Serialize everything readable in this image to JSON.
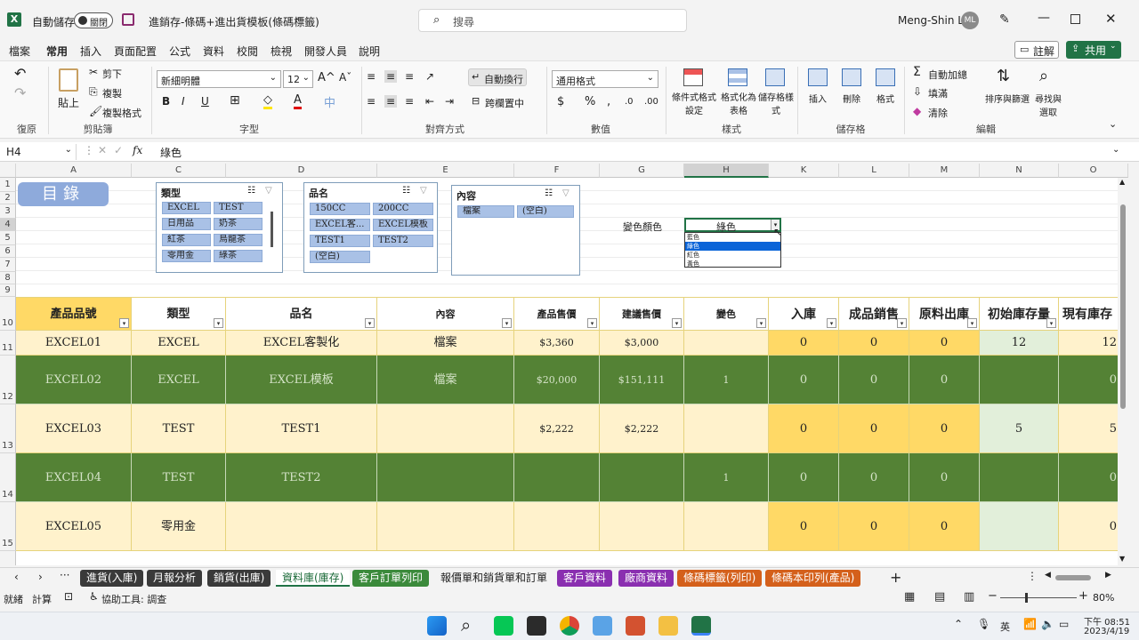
{
  "titlebar": {
    "autosave_label": "自動儲存",
    "autosave_state": "關閉",
    "doc_title": "進銷存-條碼+進出貨模板(條碼標籤)",
    "search_placeholder": "搜尋",
    "user_name": "Meng-Shin Li",
    "user_initials": "ML"
  },
  "menu": {
    "items": [
      "檔案",
      "常用",
      "插入",
      "頁面配置",
      "公式",
      "資料",
      "校閱",
      "檢視",
      "開發人員",
      "說明"
    ],
    "comment_label": "註解",
    "share_label": "共用"
  },
  "ribbon": {
    "undo_group": "復原",
    "clipboard": {
      "paste": "貼上",
      "cut": "剪下",
      "copy": "複製",
      "format_painter": "複製格式",
      "label": "剪貼簿"
    },
    "font": {
      "name": "新細明體",
      "size": "12",
      "label": "字型"
    },
    "align": {
      "wrap": "自動換行",
      "merge": "跨欄置中",
      "label": "對齊方式"
    },
    "number": {
      "format": "通用格式",
      "label": "數值"
    },
    "styles": {
      "conditional": "條件式格式設定",
      "table": "格式化為表格",
      "cell_styles": "儲存格樣式",
      "label": "樣式"
    },
    "cells": {
      "insert": "插入",
      "delete": "刪除",
      "format": "格式",
      "label": "儲存格"
    },
    "editing": {
      "autosum": "自動加總",
      "fill": "填滿",
      "clear": "清除",
      "sort": "排序與篩選",
      "find": "尋找與選取",
      "label": "編輯"
    }
  },
  "formula": {
    "name_box": "H4",
    "fx": "fx",
    "value": "綠色"
  },
  "columns": [
    "A",
    "C",
    "D",
    "E",
    "F",
    "G",
    "H",
    "K",
    "L",
    "M",
    "N",
    "O"
  ],
  "rows": [
    "1",
    "2",
    "3",
    "4",
    "5",
    "6",
    "7",
    "8",
    "9",
    "10",
    "11",
    "12",
    "13",
    "14",
    "15"
  ],
  "catalog_button": "目錄",
  "slicers": {
    "type": {
      "title": "類型",
      "items": [
        "EXCEL",
        "TEST",
        "日用品",
        "奶茶",
        "紅茶",
        "烏龍茶",
        "零用金",
        "綠茶"
      ]
    },
    "name": {
      "title": "品名",
      "items": [
        "150CC",
        "200CC",
        "EXCEL客...",
        "EXCEL模板",
        "TEST1",
        "TEST2",
        "(空白)"
      ]
    },
    "content": {
      "title": "內容",
      "items": [
        "檔案",
        "(空白)"
      ]
    }
  },
  "color_picker": {
    "label": "變色顏色",
    "value": "綠色",
    "options": [
      "藍色",
      "綠色",
      "紅色",
      "黃色"
    ]
  },
  "table": {
    "headers": [
      "產品品號",
      "類型",
      "品名",
      "內容",
      "產品售價",
      "建議售價",
      "變色",
      "入庫",
      "成品銷售",
      "原料出庫",
      "初始庫存量",
      "現有庫存"
    ],
    "rows": [
      [
        "EXCEL01",
        "EXCEL",
        "EXCEL客製化",
        "檔案",
        "$3,360",
        "$3,000",
        "",
        "0",
        "0",
        "0",
        "12",
        "12"
      ],
      [
        "EXCEL02",
        "EXCEL",
        "EXCEL模板",
        "檔案",
        "$20,000",
        "$151,111",
        "1",
        "0",
        "0",
        "0",
        "",
        "0"
      ],
      [
        "EXCEL03",
        "TEST",
        "TEST1",
        "",
        "$2,222",
        "$2,222",
        "",
        "0",
        "0",
        "0",
        "5",
        "5"
      ],
      [
        "EXCEL04",
        "TEST",
        "TEST2",
        "",
        "",
        "",
        "1",
        "0",
        "0",
        "0",
        "",
        "0"
      ],
      [
        "EXCEL05",
        "零用金",
        "",
        "",
        "",
        "",
        "",
        "0",
        "0",
        "0",
        "",
        "0"
      ]
    ]
  },
  "sheet_tabs": [
    {
      "label": "進貨(入庫)",
      "color": "#3a3a3a"
    },
    {
      "label": "月報分析",
      "color": "#3a3a3a"
    },
    {
      "label": "銷貨(出庫)",
      "color": "#3a3a3a"
    },
    {
      "label": "資料庫(庫存)",
      "color": "active"
    },
    {
      "label": "客戶訂單列印",
      "color": "#3b8a3b"
    },
    {
      "label": "報價單和銷貨單和訂單",
      "color": "plain"
    },
    {
      "label": "客戶資料",
      "color": "#8a2fb0"
    },
    {
      "label": "廠商資料",
      "color": "#8a2fb0"
    },
    {
      "label": "條碼標籤(列印)",
      "color": "#d4601b"
    },
    {
      "label": "條碼本印列(產品)",
      "color": "#d4601b"
    }
  ],
  "status": {
    "ready": "就緒",
    "calc": "計算",
    "accessibility": "協助工具: 調查",
    "zoom": "80%"
  },
  "taskbar": {
    "lang": "英",
    "time": "下午 08:51",
    "date": "2023/4/19"
  },
  "colors": {
    "excel_green": "#217346",
    "row_light": "#fff2cc",
    "row_dark": "#548235",
    "mvp_orange": "#ffd966"
  }
}
